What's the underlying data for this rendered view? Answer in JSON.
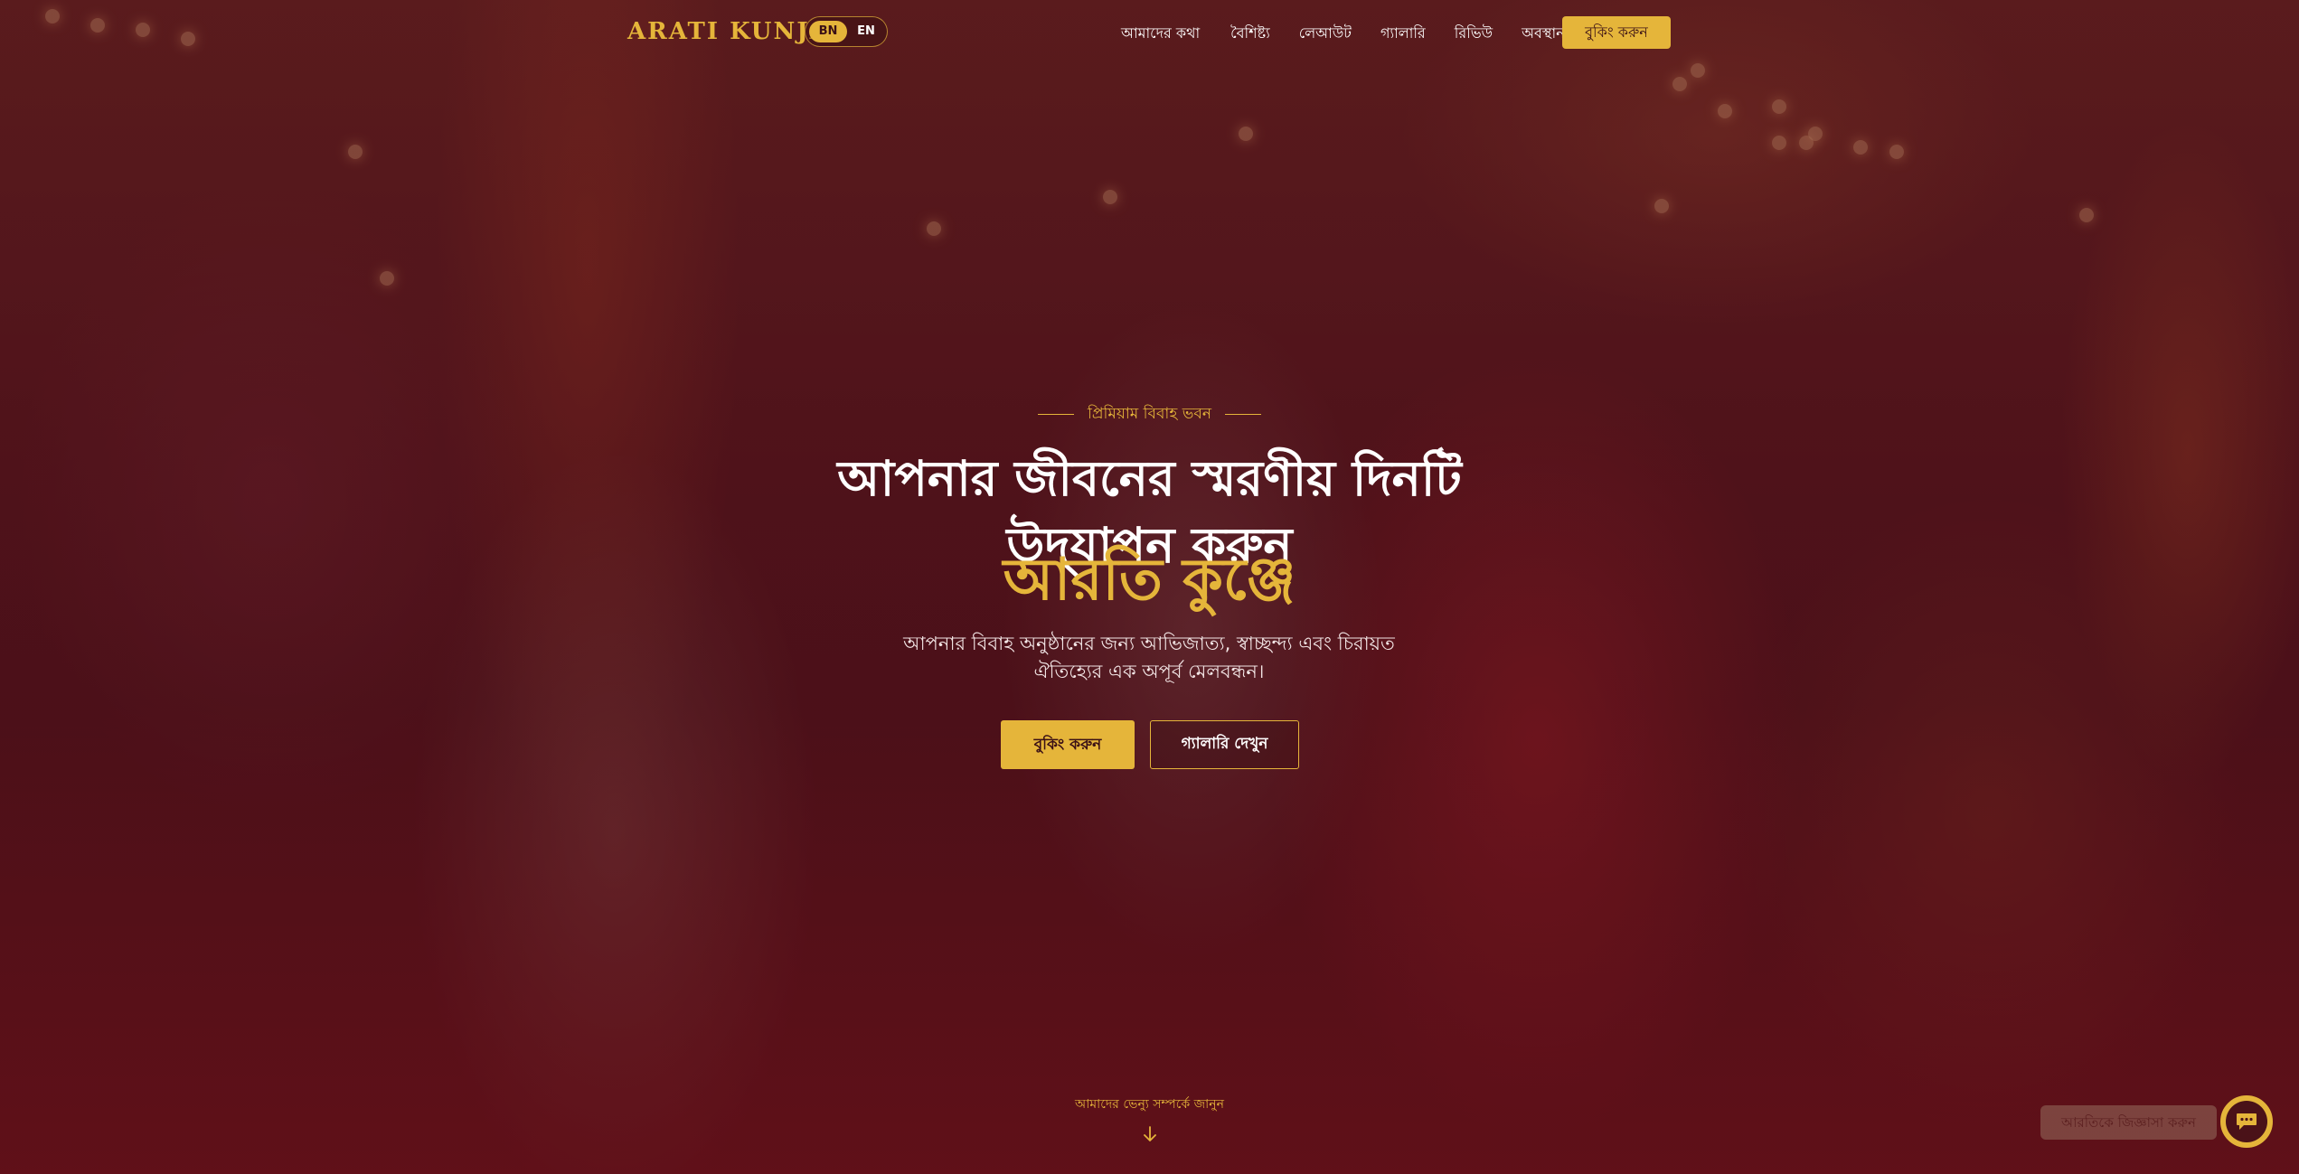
{
  "nav": {
    "brand": "ARATI KUNJA",
    "lang": {
      "active": "BN",
      "inactive": "EN"
    },
    "links": [
      "আমাদের কথা",
      "বৈশিষ্ট্য",
      "লেআউট",
      "গ্যালারি",
      "রিভিউ",
      "অবস্থান"
    ],
    "cta_label": "বুকিং করুন"
  },
  "hero": {
    "eyebrow": "প্রিমিয়াম বিবাহ ভবন",
    "headline_line1": "আপনার জীবনের স্মরণীয় দিনটি",
    "headline_line2": "উদ্‌যাপন করুন",
    "headline_accent": "আরতি কুঞ্জে",
    "subtitle": "আপনার বিবাহ অনুষ্ঠানের জন্য আভিজাত্য, স্বাচ্ছন্দ্য এবং চিরায়ত ঐতিহ্যের এক অপূর্ব মেলবন্ধন।",
    "primary_button": "বুকিং করুন",
    "secondary_button": "গ্যালারি দেখুন",
    "scroll_hint": "আমাদের ভেন্যু সম্পর্কে জানুন"
  },
  "chat": {
    "tooltip": "আরতিকে জিজ্ঞাসা করুন",
    "icon": "chat-icon"
  },
  "colors": {
    "accent": "#e5b53a",
    "overlay": "#5a0f19"
  }
}
